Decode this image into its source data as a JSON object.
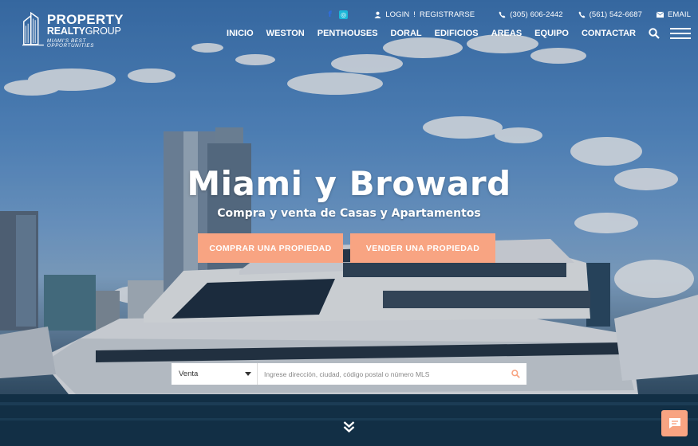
{
  "brand": {
    "line1": "PROPERTY",
    "line2_bold": "REALTY",
    "line2_rest": "GROUP",
    "tagline": "MIAMI'S BEST OPPORTUNITIES"
  },
  "topbar": {
    "social": [
      {
        "name": "facebook-icon",
        "glyph": "f"
      },
      {
        "name": "instagram-icon",
        "glyph": "◎"
      }
    ],
    "login": "LOGIN",
    "separator": "!",
    "register": "REGISTRARSE",
    "phone1": "(305) 606-2442",
    "phone2": "(561) 542-6687",
    "email": "EMAIL"
  },
  "nav": {
    "items": [
      "INICIO",
      "WESTON",
      "PENTHOUSES",
      "DORAL",
      "EDIFICIOS",
      "AREAS",
      "EQUIPO",
      "CONTACTAR"
    ]
  },
  "hero": {
    "title": "Miami y Broward",
    "subtitle": "Compra y venta de Casas y Apartamentos",
    "cta_buy": "COMPRAR UNA PROPIEDAD",
    "cta_sell": "VENDER UNA PROPIEDAD"
  },
  "search": {
    "type_selected": "Venta",
    "placeholder": "Ingrese dirección, ciudad, código postal o número MLS"
  },
  "colors": {
    "accent": "#f8a482",
    "instagram": "#1cb8d9",
    "facebook": "#2f6ee0"
  }
}
